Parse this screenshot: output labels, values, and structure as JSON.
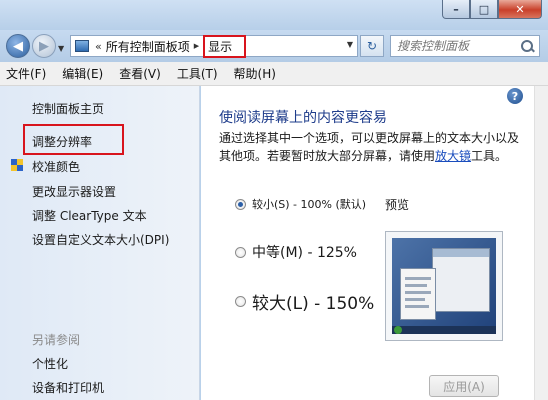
{
  "titlebar": {
    "minimize": "–",
    "maximize": "□",
    "close": "✕"
  },
  "nav": {
    "back": "◀",
    "forward": "▶",
    "recent": "▼",
    "refresh": "↻"
  },
  "address": {
    "prefix": "«",
    "breadcrumbs": [
      "所有控制面板项",
      "显示"
    ],
    "separator": "▶",
    "dropdown": "▼"
  },
  "search": {
    "placeholder": "搜索控制面板"
  },
  "menu": [
    "文件(F)",
    "编辑(E)",
    "查看(V)",
    "工具(T)",
    "帮助(H)"
  ],
  "sidebar": {
    "home": "控制面板主页",
    "items": [
      "调整分辨率",
      "校准颜色",
      "更改显示器设置",
      "调整 ClearType 文本",
      "设置自定义文本大小(DPI)"
    ],
    "see_also_title": "另请参阅",
    "see_also": [
      "个性化",
      "设备和打印机"
    ]
  },
  "main": {
    "help": "?",
    "title": "使阅读屏幕上的内容更容易",
    "desc_before": "通过选择其中一个选项，可以更改屏幕上的文本大小以及其他项。若要暂时放大部分屏幕，请使用",
    "desc_link": "放大镜",
    "desc_after": "工具。",
    "options": [
      {
        "label": "较小(S) - 100% (默认)",
        "selected": true
      },
      {
        "label": "中等(M) - 125%",
        "selected": false
      },
      {
        "label": "较大(L) - 150%",
        "selected": false
      }
    ],
    "preview_label": "预览",
    "apply": "应用(A)"
  }
}
